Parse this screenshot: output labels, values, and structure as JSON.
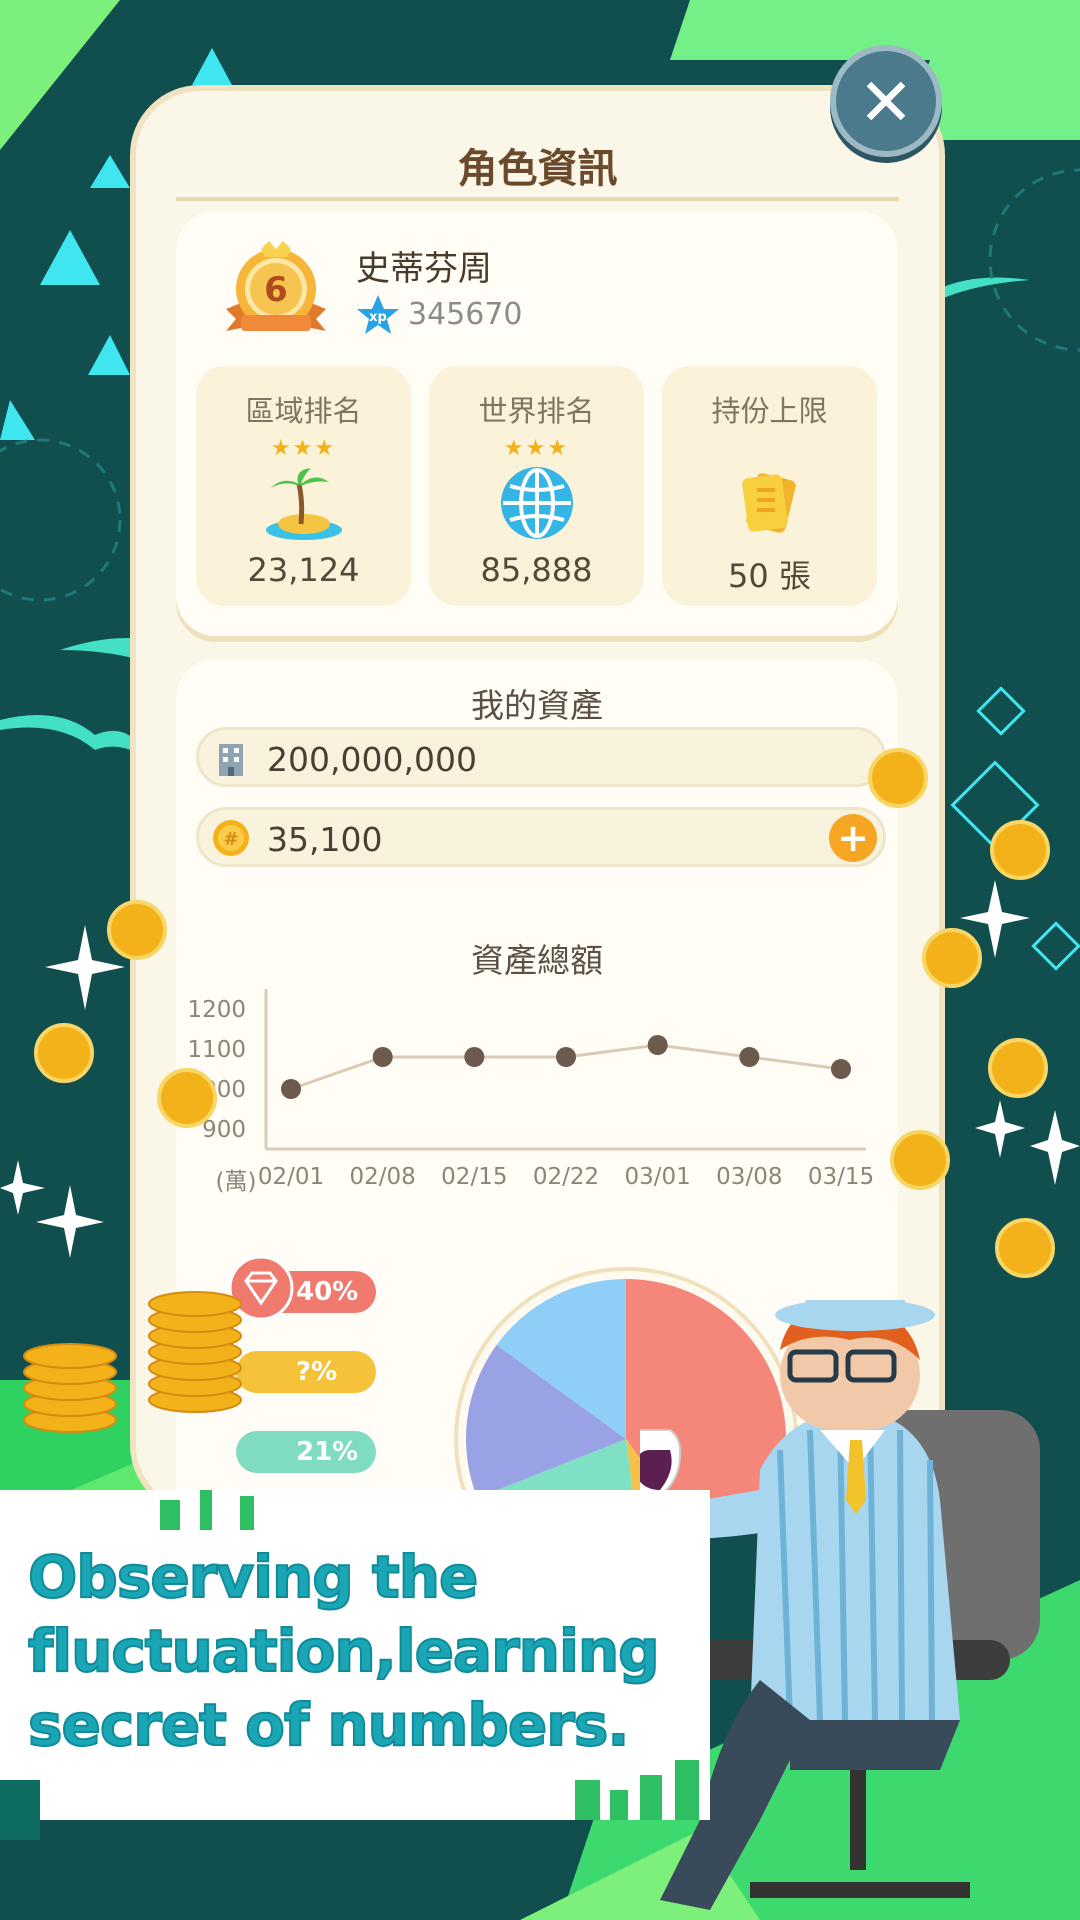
{
  "header": {
    "title": "角色資訊",
    "close_label": "✕"
  },
  "player": {
    "level": "6",
    "name": "史蒂芬周",
    "xp_label": "xp",
    "xp": "345670"
  },
  "stats": [
    {
      "label": "區域排名",
      "stars": "★★★",
      "value": "23,124",
      "icon": "island-icon"
    },
    {
      "label": "世界排名",
      "stars": "★★★",
      "value": "85,888",
      "icon": "globe-icon"
    },
    {
      "label": "持份上限",
      "stars": "",
      "value": "50 張",
      "icon": "ticket-icon"
    }
  ],
  "assets": {
    "title": "我的資產",
    "property_value": "200,000,000",
    "coin_value": "35,100",
    "add_label": "+"
  },
  "chart_data": {
    "type": "line",
    "title": "資產總額",
    "ylabel": "(萬)",
    "x": [
      "02/01",
      "02/08",
      "02/15",
      "02/22",
      "03/01",
      "03/08",
      "03/15"
    ],
    "values": [
      1000,
      1080,
      1080,
      1080,
      1110,
      1080,
      1050
    ],
    "y_ticks": [
      "1200",
      "1100",
      "1000",
      "900"
    ],
    "ylim": [
      850,
      1250
    ],
    "grid": false,
    "line_color": "#d9cbb4",
    "point_color": "#6b5a4d"
  },
  "pie_chart": {
    "type": "pie",
    "legend": [
      {
        "value": "40%",
        "color": "#f07a6e",
        "icon": "diamond-icon"
      },
      {
        "value": "?%",
        "color": "#f5c23a",
        "icon": "wine-icon"
      },
      {
        "value": "21%",
        "color": "#7fdcc0",
        "icon": "leaf-icon"
      }
    ],
    "slices": [
      {
        "value": 40,
        "color": "#f4877a"
      },
      {
        "value": 8,
        "color": "#f4c24a"
      },
      {
        "value": 21,
        "color": "#7fe0c4"
      },
      {
        "value": 16,
        "color": "#9aa2e6"
      },
      {
        "value": 15,
        "color": "#8fcff7"
      }
    ]
  },
  "banner": {
    "line1": "Observing the",
    "line2": "fluctuation,learning",
    "line3": "secret of numbers."
  },
  "colors": {
    "background": "#0f4f4f",
    "accent_green": "#4fe07a",
    "panel": "#fbf7e8"
  }
}
